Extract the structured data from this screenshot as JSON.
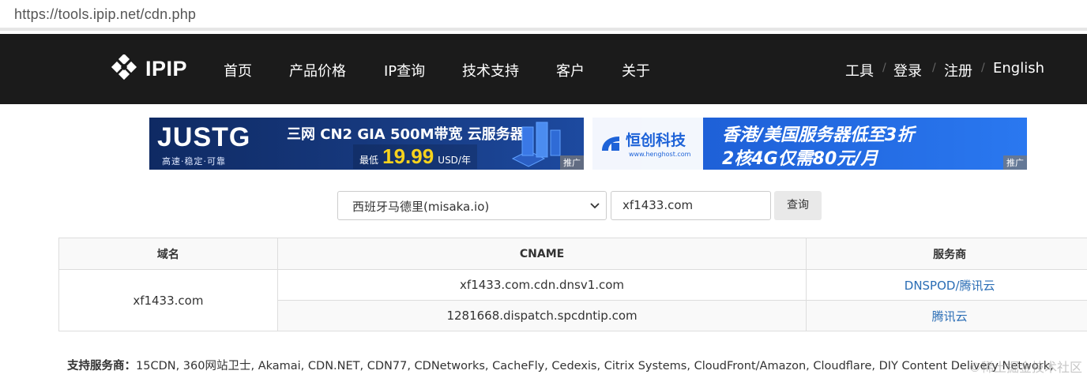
{
  "browser": {
    "url": "https://tools.ipip.net/cdn.php"
  },
  "nav": {
    "logo": "IPIP",
    "items": [
      "首页",
      "产品价格",
      "IP查询",
      "技术支持",
      "客户",
      "关于"
    ],
    "right": [
      "工具",
      "登录",
      "注册",
      "English"
    ]
  },
  "banners": [
    {
      "brand": "JUSTG",
      "slogan": "高速·稳定·可靠",
      "headline": "三网 CN2 GIA 500M带宽 云服务器",
      "price_prefix": "最低",
      "price": "19.99",
      "price_unit": "USD/年",
      "tag": "推广",
      "colors": {
        "bg": "#15306b",
        "accent": "#f6d21d"
      }
    },
    {
      "brand": "恒创科技",
      "site": "www.henghost.com",
      "line1": "香港/美国服务器低至3折",
      "line2": "2核4G仅需80元/月",
      "tag": "推广",
      "colors": {
        "bg": "#1e63d8",
        "accent": "#ffd84a"
      }
    }
  ],
  "query": {
    "location_selected": "西班牙马德里(misaka.io)",
    "domain_value": "xf1433.com",
    "button_label": "查询"
  },
  "table": {
    "headers": [
      "域名",
      "CNAME",
      "服务商"
    ],
    "domain": "xf1433.com",
    "rows": [
      {
        "cname": "xf1433.com.cdn.dnsv1.com",
        "provider": "DNSPOD/腾讯云"
      },
      {
        "cname": "1281668.dispatch.spcdntip.com",
        "provider": "腾讯云"
      }
    ]
  },
  "support": {
    "label": "支持服务商：",
    "list": "15CDN, 360网站卫士, Akamai, CDN.NET, CDN77, CDNetworks, CacheFly, Cedexis, Citrix Systems, CloudFront/Amazon, Cloudflare, DIY Content Delivery Network,"
  },
  "watermark": "©稀土掘金技术社区"
}
